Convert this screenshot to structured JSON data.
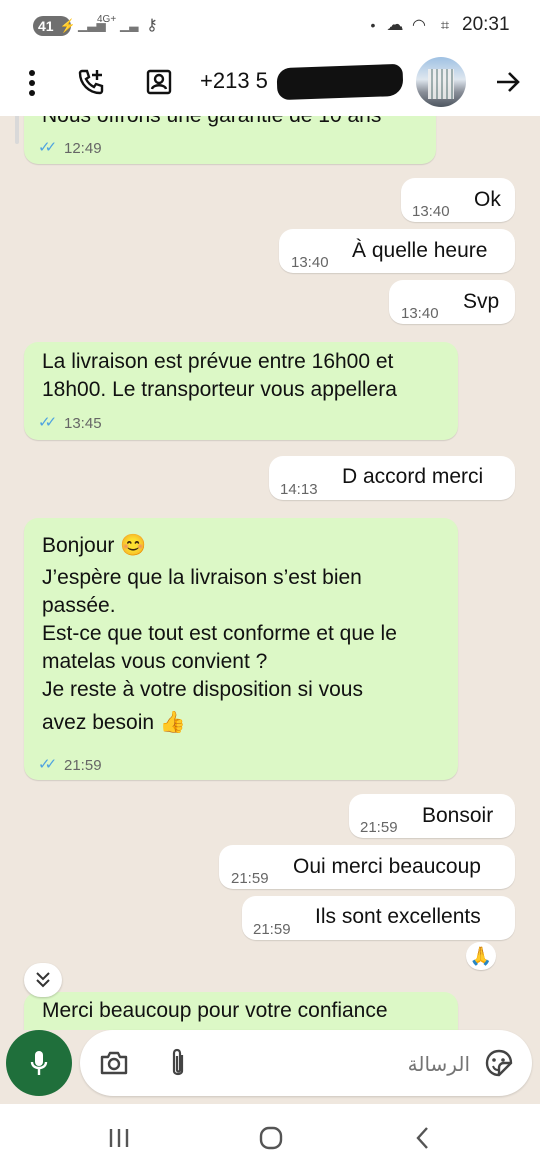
{
  "status_bar": {
    "battery": "41",
    "network": "4G+",
    "time": "20:31"
  },
  "header": {
    "phone_number": "+213 5",
    "icons": [
      "more-icon",
      "add-call-icon",
      "contact-card-icon",
      "forward-arrow-icon"
    ]
  },
  "messages": [
    {
      "dir": "in",
      "text": [
        "Nous offrons une garantie de 10 ans"
      ],
      "time": "12:49",
      "read": true
    },
    {
      "dir": "out",
      "text": [
        "Ok"
      ],
      "time": "13:40"
    },
    {
      "dir": "out",
      "text": [
        "À quelle heure"
      ],
      "time": "13:40"
    },
    {
      "dir": "out",
      "text": [
        "Svp"
      ],
      "time": "13:40"
    },
    {
      "dir": "in",
      "text": [
        "La livraison est prévue entre 16h00 et",
        "18h00. Le transporteur vous appellera"
      ],
      "time": "13:45",
      "read": true
    },
    {
      "dir": "out",
      "text": [
        "D accord merci"
      ],
      "time": "14:13"
    },
    {
      "dir": "in",
      "text": [
        "Bonjour 😊",
        "J’espère que la livraison s’est bien",
        "passée.",
        "Est-ce que tout est conforme et que le",
        "matelas vous convient ?",
        "Je reste à votre disposition si vous",
        "avez besoin 👍"
      ],
      "time": "21:59",
      "read": true
    },
    {
      "dir": "out",
      "text": [
        "Bonsoir"
      ],
      "time": "21:59"
    },
    {
      "dir": "out",
      "text": [
        "Oui merci beaucoup"
      ],
      "time": "21:59"
    },
    {
      "dir": "out",
      "text": [
        "Ils sont excellents"
      ],
      "time": "21:59",
      "reaction": "🙏"
    },
    {
      "dir": "in",
      "text": [
        "Merci beaucoup pour votre confiance"
      ],
      "time": ""
    }
  ],
  "composer": {
    "placeholder": "الرسالة"
  },
  "colors": {
    "incoming_bubble": "#dcf8c6",
    "outgoing_bubble": "#ffffff",
    "chat_bg": "#efe7de",
    "mic_button": "#1f6f3b",
    "read_ticks": "#4fa3e0"
  }
}
